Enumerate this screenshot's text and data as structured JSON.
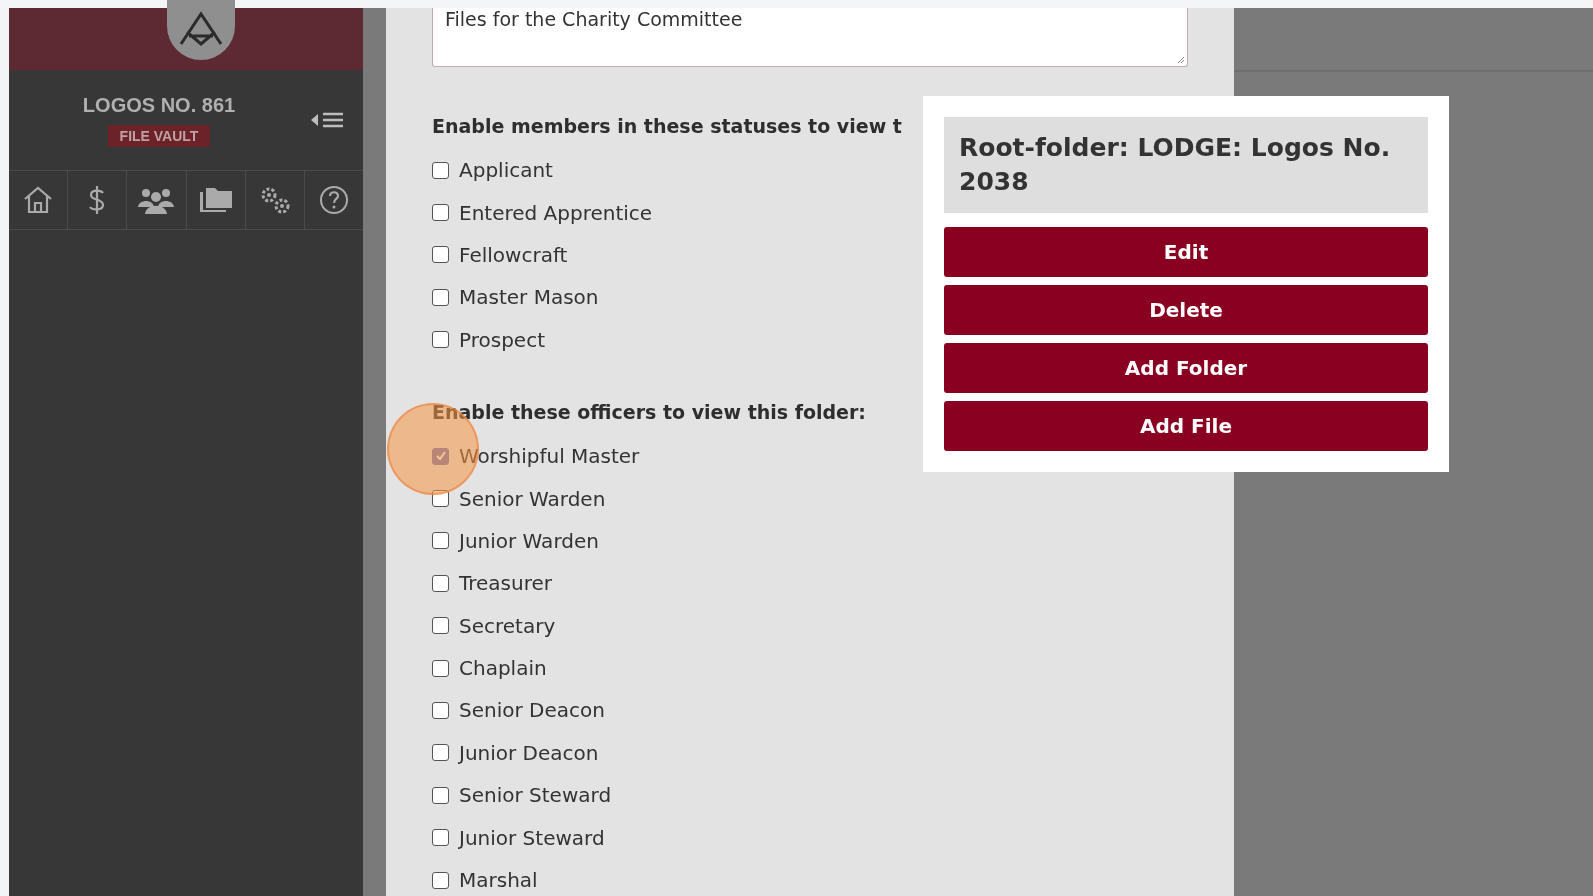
{
  "sidebar": {
    "lodge_name": "LOGOS NO. 861",
    "section_badge": "FILE VAULT"
  },
  "modal": {
    "description_value": "Files for the Charity Committee",
    "statuses": {
      "heading": "Enable members in these statuses to view t",
      "items": [
        {
          "label": "Applicant",
          "checked": false
        },
        {
          "label": "Entered Apprentice",
          "checked": false
        },
        {
          "label": "Fellowcraft",
          "checked": false
        },
        {
          "label": "Master Mason",
          "checked": false
        },
        {
          "label": "Prospect",
          "checked": false
        }
      ]
    },
    "officers": {
      "heading": "Enable these officers to view this folder:",
      "items": [
        {
          "label": "Worshipful Master",
          "checked": true
        },
        {
          "label": "Senior Warden",
          "checked": false
        },
        {
          "label": "Junior Warden",
          "checked": false
        },
        {
          "label": "Treasurer",
          "checked": false
        },
        {
          "label": "Secretary",
          "checked": false
        },
        {
          "label": "Chaplain",
          "checked": false
        },
        {
          "label": "Senior Deacon",
          "checked": false
        },
        {
          "label": "Junior Deacon",
          "checked": false
        },
        {
          "label": "Senior Steward",
          "checked": false
        },
        {
          "label": "Junior Steward",
          "checked": false
        },
        {
          "label": "Marshal",
          "checked": false
        }
      ]
    }
  },
  "folder_menu": {
    "title": "Root-folder: LODGE: Logos No. 2038",
    "buttons": [
      "Edit",
      "Delete",
      "Add Folder",
      "Add File"
    ]
  }
}
